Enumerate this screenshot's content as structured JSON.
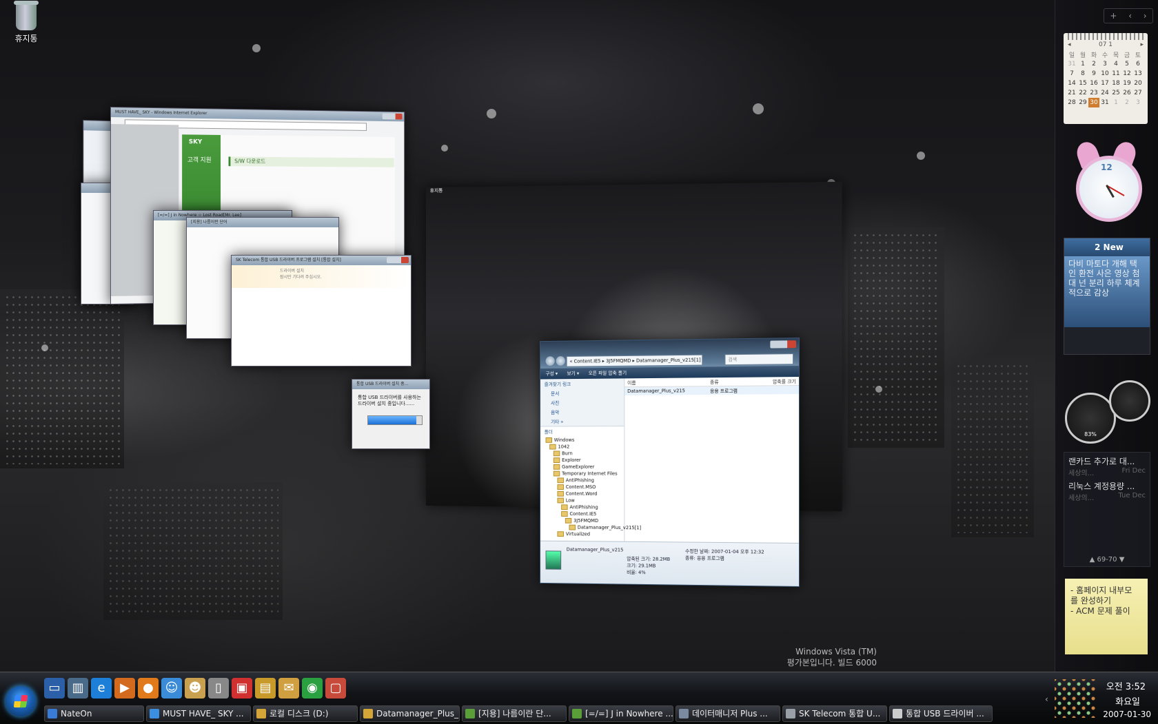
{
  "desktop": {
    "recycle_bin": "휴지통",
    "watermark": {
      "line1": "Windows Vista (TM)",
      "line2": "평가본입니다. 빌드 6000"
    }
  },
  "windows": {
    "ie": {
      "title": "MUST HAVE_ SKY - Windows Internet Explorer",
      "brand": "SKY",
      "nav_heading": "고객 지원",
      "section": "S/W 다운로드"
    },
    "jin": {
      "title": "[=/=] J in Nowhere ☆ Lost Road[Mr. Lee]"
    },
    "narum": {
      "title": "[지용] 나름이란 단어"
    },
    "skt": {
      "title": "SK Telecom 통합 USB 드라이버 프로그램 설치 [통합 설치]",
      "line1": "드라이버 설치",
      "line2": "잠시만 기다려 주십시오."
    },
    "usb": {
      "title": "통합 USB 드라이버 설치 중...",
      "message": "통합 USB 드라이버를 사용하는 드라이버 설치 중입니다......",
      "progress": 0.9
    },
    "wallpaper_preview": {
      "recycle_label": "휴지통"
    },
    "explorer": {
      "breadcrumb": "« Content.IE5 ▸ 3J5FMQMD ▸ Datamanager_Plus_v215[1]",
      "search_placeholder": "검색",
      "cmd": [
        "구성 ▾",
        "보기 ▾",
        "오픈 파일 압축 풀기"
      ],
      "fav_header": "즐겨찾기 링크",
      "favs": [
        "문서",
        "사진",
        "음악",
        "기타 »"
      ],
      "folder_header": "폴더",
      "tree": [
        "Windows",
        "1042",
        "Burn",
        "Explorer",
        "GameExplorer",
        "Temporary Internet Files",
        "AntiPhishing",
        "Content.MSO",
        "Content.Word",
        "Low",
        "AntiPhishing",
        "Content.IE5",
        "3J5FMQMD",
        "Datamanager_Plus_v215[1]",
        "Virtualized"
      ],
      "columns": {
        "name": "이름",
        "type": "종류",
        "ratio": "압축률 크기"
      },
      "file": {
        "name": "Datamanager_Plus_v215",
        "type": "응용 프로그램"
      },
      "details": {
        "name": "Datamanager_Plus_v215",
        "packed_label": "압축된 크기:",
        "packed": "28.2MB",
        "size_label": "크기:",
        "size": "29.1MB",
        "ratio_label": "비율:",
        "ratio": "4%",
        "modified_label": "수정한 날짜:",
        "modified": "2007-01-04 오후 12:32",
        "type_label": "종류:",
        "type": "응용 프로그램"
      }
    }
  },
  "sidebar": {
    "top_controls": [
      "+",
      "‹",
      "›"
    ],
    "calendar": {
      "month": "07 1",
      "dow": [
        "일",
        "월",
        "화",
        "수",
        "목",
        "금",
        "토"
      ],
      "weeks": [
        [
          "31",
          "1",
          "2",
          "3",
          "4",
          "5",
          "6"
        ],
        [
          "7",
          "8",
          "9",
          "10",
          "11",
          "12",
          "13"
        ],
        [
          "14",
          "15",
          "16",
          "17",
          "18",
          "19",
          "20"
        ],
        [
          "21",
          "22",
          "23",
          "24",
          "25",
          "26",
          "27"
        ],
        [
          "28",
          "29",
          "30",
          "31",
          "1",
          "2",
          "3"
        ]
      ],
      "today": "30"
    },
    "clock": {
      "number": "12"
    },
    "news": {
      "header": "2 New",
      "body": "다비 마토다 개해 택 인 환전 사은 영상 첨대 넌 분리 하루 체계적으로 감상"
    },
    "meters": {
      "cpu": "83%"
    },
    "rss": {
      "items": [
        {
          "title": "랜카드 추가로 대...",
          "source": "세상의...",
          "date": "Fri Dec"
        },
        {
          "title": "리눅스 계정용량 ...",
          "source": "세상의...",
          "date": "Tue Dec"
        }
      ],
      "pager": "▲ 69-70 ▼"
    },
    "note": {
      "lines": [
        "- 홈페이지 내부모",
        "를 완성하기",
        "- ACM 문제 풀이"
      ]
    }
  },
  "taskbar": {
    "quick_launch": [
      "show-desktop",
      "switch-windows",
      "internet-explorer",
      "media-player",
      "nateon",
      "messenger",
      "finder",
      "package",
      "usb-tool",
      "folders",
      "mail",
      "green-app",
      "talk"
    ],
    "tasks": [
      {
        "label": "NateOn",
        "color": "#3a7bd5"
      },
      {
        "label": "MUST HAVE_ SKY ...",
        "color": "#3b8ee0"
      },
      {
        "label": "로컬 디스크 (D:)",
        "color": "#d4a637"
      },
      {
        "label": "Datamanager_Plus_...",
        "color": "#d4a637"
      },
      {
        "label": "[지용] 나름이란 단...",
        "color": "#5a9e3a"
      },
      {
        "label": "[=/=] J in Nowhere ...",
        "color": "#5a9e3a"
      },
      {
        "label": "데이터매니저 Plus ...",
        "color": "#7a8aa0"
      },
      {
        "label": "SK Telecom 통합 U...",
        "color": "#9aa0a8"
      },
      {
        "label": "통합 USB 드라이버 ...",
        "color": "#cccccc"
      }
    ],
    "clock": {
      "time": "오전 3:52",
      "weekday": "화요일",
      "date": "2007-01-30"
    }
  }
}
